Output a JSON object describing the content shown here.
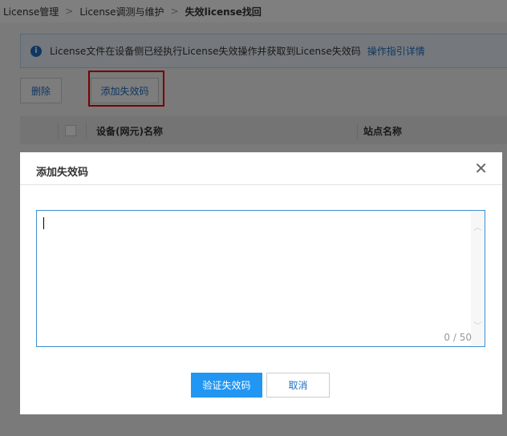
{
  "breadcrumb": [
    "License管理",
    "License调测与维护",
    "失效license找回"
  ],
  "info": {
    "icon": "info-icon",
    "text": "License文件在设备侧已经执行License失效操作并获取到License失效码",
    "link": "操作指引详情"
  },
  "toolbar": {
    "delete": "删除",
    "add": "添加失效码"
  },
  "table": {
    "columns": [
      "设备(网元)名称",
      "站点名称"
    ]
  },
  "dialog": {
    "title": "添加失效码",
    "textarea_value": "",
    "counter": "0 / 50",
    "confirm": "验证失效码",
    "cancel": "取消"
  },
  "colors": {
    "primary": "#2196f3",
    "link": "#1f6fc4",
    "highlight": "#e00000"
  }
}
